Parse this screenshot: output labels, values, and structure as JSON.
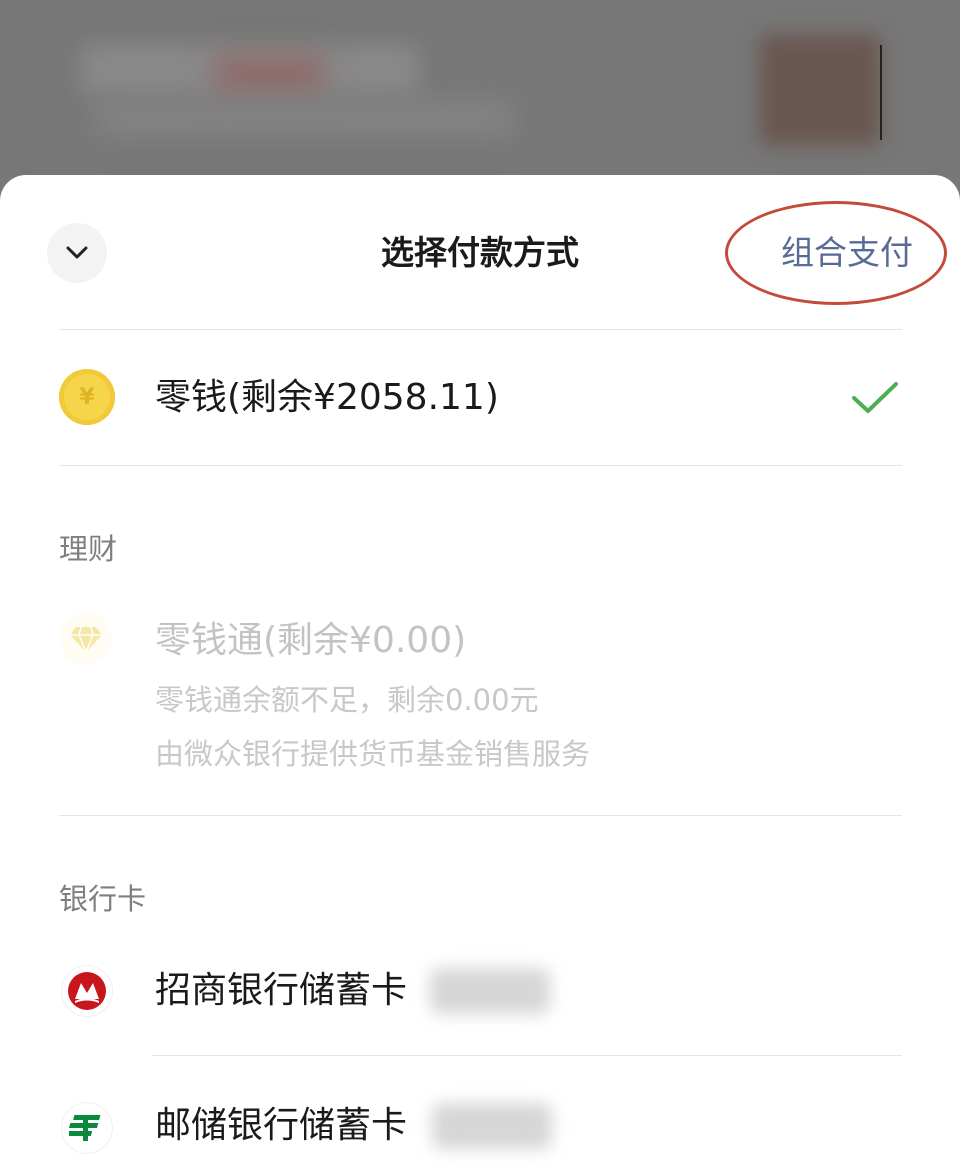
{
  "sheet": {
    "title": "选择付款方式",
    "combo_pay_label": "组合支付"
  },
  "balance": {
    "label": "零钱(剩余¥2058.11)",
    "icon": "yuan-coin-icon",
    "selected": true
  },
  "wealth": {
    "section_title": "理财",
    "item": {
      "label": "零钱通(剩余¥0.00)",
      "note": "零钱通余额不足，剩余0.00元",
      "provider": "由微众银行提供货币基金销售服务",
      "icon": "diamond-icon",
      "enabled": false
    }
  },
  "bank_cards": {
    "section_title": "银行卡",
    "items": [
      {
        "label": "招商银行储蓄卡",
        "icon": "cmb-logo-icon"
      },
      {
        "label": "邮储银行储蓄卡",
        "icon": "psbc-logo-icon"
      }
    ]
  },
  "colors": {
    "link": "#576b95",
    "check": "#4caf50",
    "annotation_ring": "#c44a3a"
  }
}
